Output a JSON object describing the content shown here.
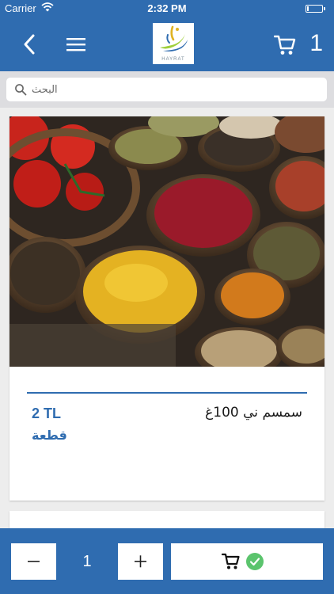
{
  "status_bar": {
    "carrier": "Carrier",
    "time": "2:32 PM",
    "battery_level": 0.12
  },
  "header": {
    "logo_text": "HAYRAT",
    "cart_count": "1"
  },
  "search": {
    "placeholder": "البحث"
  },
  "product": {
    "name": "سمسم ني 100غ",
    "price": "2 TL",
    "unit": "قطعة"
  },
  "quantity": {
    "value": "1"
  },
  "colors": {
    "brand_blue": "#2f6cb0",
    "check_green": "#5bc46d"
  }
}
